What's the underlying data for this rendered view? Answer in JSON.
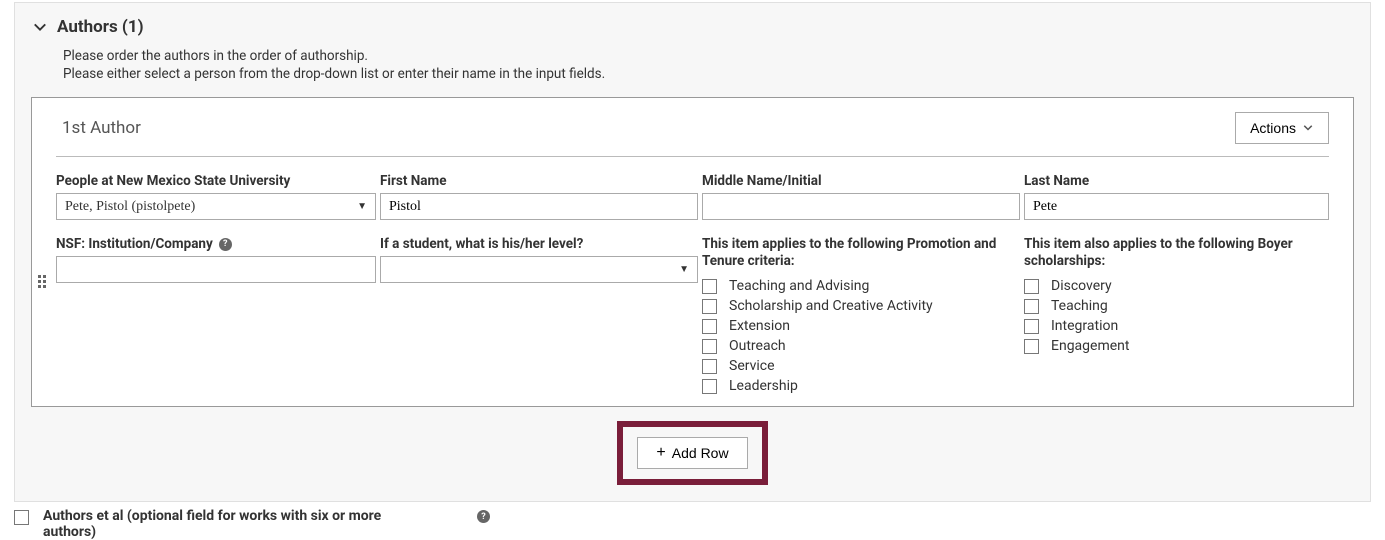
{
  "section": {
    "title": "Authors (1)",
    "instruction_line1": "Please order the authors in the order of authorship.",
    "instruction_line2": "Please either select a person from the drop-down list or enter their name in the input fields."
  },
  "author": {
    "ordinal": "1st Author",
    "actions_label": "Actions",
    "fields": {
      "people_label": "People at New Mexico State University",
      "people_value": "Pete, Pistol (pistolpete)",
      "first_name_label": "First Name",
      "first_name_value": "Pistol",
      "middle_name_label": "Middle Name/Initial",
      "middle_name_value": "",
      "last_name_label": "Last Name",
      "last_name_value": "Pete",
      "nsf_label": "NSF: Institution/Company",
      "nsf_value": "",
      "student_level_label": "If a student, what is his/her level?",
      "student_level_value": "",
      "promotion_label": "This item applies to the following Promotion and Tenure criteria:",
      "boyer_label": "This item also applies to the following Boyer scholarships:"
    },
    "promotion_options": [
      "Teaching and Advising",
      "Scholarship and Creative Activity",
      "Extension",
      "Outreach",
      "Service",
      "Leadership"
    ],
    "boyer_options": [
      "Discovery",
      "Teaching",
      "Integration",
      "Engagement"
    ]
  },
  "add_row_label": "Add Row",
  "bottom": {
    "label": "Authors et al (optional field for works with six or more authors)"
  }
}
